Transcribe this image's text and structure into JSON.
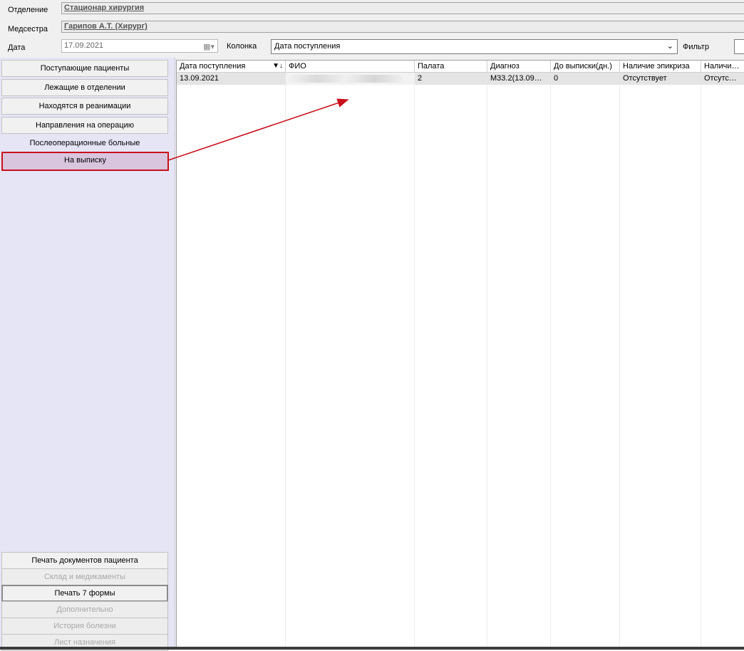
{
  "header": {
    "department_label": "Отделение",
    "department_value": "Стационар  хирургия",
    "nurse_label": "Медсестра",
    "nurse_value": "Гарипов А.Т. (Хирург)",
    "date_label": "Дата",
    "date_value": "17.09.2021",
    "column_label": "Колонка",
    "column_value": "Дата поступления",
    "filter_label": "Фильтр",
    "filter_value": ""
  },
  "sidebar": {
    "top_items": [
      {
        "label": "Поступающие пациенты"
      },
      {
        "label": "Лежащие в отделении"
      },
      {
        "label": "Находятся в реанимации"
      },
      {
        "label": "Направления на операцию"
      },
      {
        "label": "Послеоперационные больные"
      },
      {
        "label": "На выписку"
      }
    ],
    "bottom_items": [
      {
        "label": "Печать документов пациента"
      },
      {
        "label": "Склад и медикаменты"
      },
      {
        "label": "Печать 7 формы"
      },
      {
        "label": "Дополнительно"
      },
      {
        "label": "История болезни"
      },
      {
        "label": "Лист назначения"
      }
    ]
  },
  "grid": {
    "columns": [
      "Дата поступления",
      "ФИО",
      "Палата",
      "Диагноз",
      "До выписки(дн.)",
      "Наличие эпикриза",
      "Наличи…"
    ],
    "rows": [
      [
        "13.09.2021",
        "",
        "2",
        "M33.2(13.09…",
        "0",
        "Отсутствует",
        "Отсутс…"
      ]
    ]
  },
  "colors": {
    "sidebar_bg": "#e5e5f6",
    "active_border": "#c8101b",
    "active_bg": "#d9c6de",
    "annotation_arrow": "#c8101b"
  }
}
